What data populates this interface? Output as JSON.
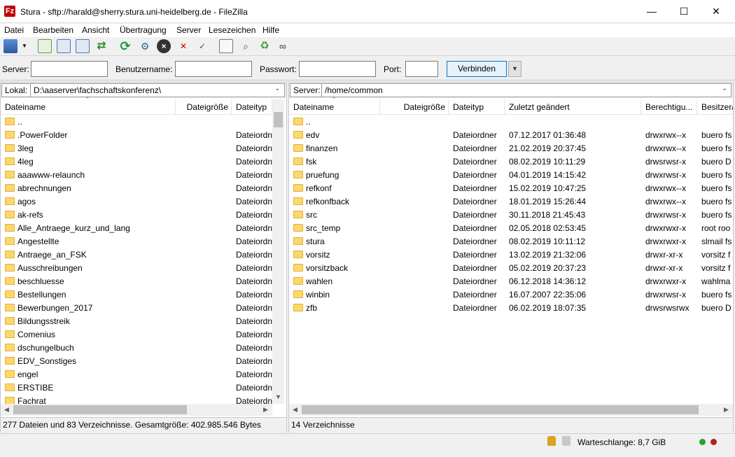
{
  "window": {
    "title": "Stura - sftp://harald@sherry.stura.uni-heidelberg.de - FileZilla",
    "app_icon": "Fz",
    "minimize": "—",
    "maximize": "☐",
    "close": "✕"
  },
  "menu": [
    "Datei",
    "Bearbeiten",
    "Ansicht",
    "Übertragung",
    "Server",
    "Lesezeichen",
    "Hilfe"
  ],
  "quickconnect": {
    "server_label": "Server:",
    "user_label": "Benutzername:",
    "pass_label": "Passwort:",
    "port_label": "Port:",
    "connect_label": "Verbinden",
    "server_value": "",
    "user_value": "",
    "pass_value": "",
    "port_value": ""
  },
  "local": {
    "label": "Lokal:",
    "path": "D:\\aaserver\\fachschaftskonferenz\\",
    "columns": [
      "Dateiname",
      "Dateigröße",
      "Dateityp"
    ],
    "rows": [
      {
        "name": "..",
        "type": ""
      },
      {
        "name": ".PowerFolder",
        "type": "Dateiordn"
      },
      {
        "name": "3leg",
        "type": "Dateiordn"
      },
      {
        "name": "4leg",
        "type": "Dateiordn"
      },
      {
        "name": "aaawww-relaunch",
        "type": "Dateiordn"
      },
      {
        "name": "abrechnungen",
        "type": "Dateiordn"
      },
      {
        "name": "agos",
        "type": "Dateiordn"
      },
      {
        "name": "ak-refs",
        "type": "Dateiordn"
      },
      {
        "name": "Alle_Antraege_kurz_und_lang",
        "type": "Dateiordn"
      },
      {
        "name": "Angestellte",
        "type": "Dateiordn"
      },
      {
        "name": "Antraege_an_FSK",
        "type": "Dateiordn"
      },
      {
        "name": "Ausschreibungen",
        "type": "Dateiordn"
      },
      {
        "name": "beschluesse",
        "type": "Dateiordn"
      },
      {
        "name": "Bestellungen",
        "type": "Dateiordn"
      },
      {
        "name": "Bewerbungen_2017",
        "type": "Dateiordn"
      },
      {
        "name": "Bildungsstreik",
        "type": "Dateiordn"
      },
      {
        "name": "Comenius",
        "type": "Dateiordn"
      },
      {
        "name": "dschungelbuch",
        "type": "Dateiordn"
      },
      {
        "name": "EDV_Sonstiges",
        "type": "Dateiordn"
      },
      {
        "name": "engel",
        "type": "Dateiordn"
      },
      {
        "name": "ERSTIBE",
        "type": "Dateiordn"
      },
      {
        "name": "Fachrat",
        "type": "Dateiordn"
      }
    ],
    "status": "277 Dateien und 83 Verzeichnisse. Gesamtgröße: 402.985.546 Bytes"
  },
  "remote": {
    "label": "Server:",
    "path": "/home/common",
    "columns": [
      "Dateiname",
      "Dateigröße",
      "Dateityp",
      "Zuletzt geändert",
      "Berechtigu...",
      "Besitzer/"
    ],
    "rows": [
      {
        "name": "..",
        "type": "",
        "modified": "",
        "perm": "",
        "owner": ""
      },
      {
        "name": "edv",
        "type": "Dateiordner",
        "modified": "07.12.2017 01:36:48",
        "perm": "drwxrwx--x",
        "owner": "buero fs"
      },
      {
        "name": "finanzen",
        "type": "Dateiordner",
        "modified": "21.02.2019 20:37:45",
        "perm": "drwxrwx--x",
        "owner": "buero fs"
      },
      {
        "name": "fsk",
        "type": "Dateiordner",
        "modified": "08.02.2019 10:11:29",
        "perm": "drwsrwsr-x",
        "owner": "buero D"
      },
      {
        "name": "pruefung",
        "type": "Dateiordner",
        "modified": "04.01.2019 14:15:42",
        "perm": "drwxrwsr-x",
        "owner": "buero fs"
      },
      {
        "name": "refkonf",
        "type": "Dateiordner",
        "modified": "15.02.2019 10:47:25",
        "perm": "drwxrwx--x",
        "owner": "buero fs"
      },
      {
        "name": "refkonfback",
        "type": "Dateiordner",
        "modified": "18.01.2019 15:26:44",
        "perm": "drwxrwx--x",
        "owner": "buero fs"
      },
      {
        "name": "src",
        "type": "Dateiordner",
        "modified": "30.11.2018 21:45:43",
        "perm": "drwxrwsr-x",
        "owner": "buero fs"
      },
      {
        "name": "src_temp",
        "type": "Dateiordner",
        "modified": "02.05.2018 02:53:45",
        "perm": "drwxrwxr-x",
        "owner": "root roo"
      },
      {
        "name": "stura",
        "type": "Dateiordner",
        "modified": "08.02.2019 10:11:12",
        "perm": "drwxrwxr-x",
        "owner": "slmail fs"
      },
      {
        "name": "vorsitz",
        "type": "Dateiordner",
        "modified": "13.02.2019 21:32:06",
        "perm": "drwxr-xr-x",
        "owner": "vorsitz f"
      },
      {
        "name": "vorsitzback",
        "type": "Dateiordner",
        "modified": "05.02.2019 20:37:23",
        "perm": "drwxr-xr-x",
        "owner": "vorsitz f"
      },
      {
        "name": "wahlen",
        "type": "Dateiordner",
        "modified": "06.12.2018 14:36:12",
        "perm": "drwxrwxr-x",
        "owner": "wahlma"
      },
      {
        "name": "winbin",
        "type": "Dateiordner",
        "modified": "16.07.2007 22:35:06",
        "perm": "drwxrwsr-x",
        "owner": "buero fs"
      },
      {
        "name": "zfb",
        "type": "Dateiordner",
        "modified": "06.02.2019 18:07:35",
        "perm": "drwsrwsrwx",
        "owner": "buero D"
      }
    ],
    "status": "14 Verzeichnisse"
  },
  "bottom": {
    "queue": "Warteschlange: 8,7 GiB"
  },
  "colors": {
    "folder": "#ffd769",
    "accent": "#0078d7"
  }
}
